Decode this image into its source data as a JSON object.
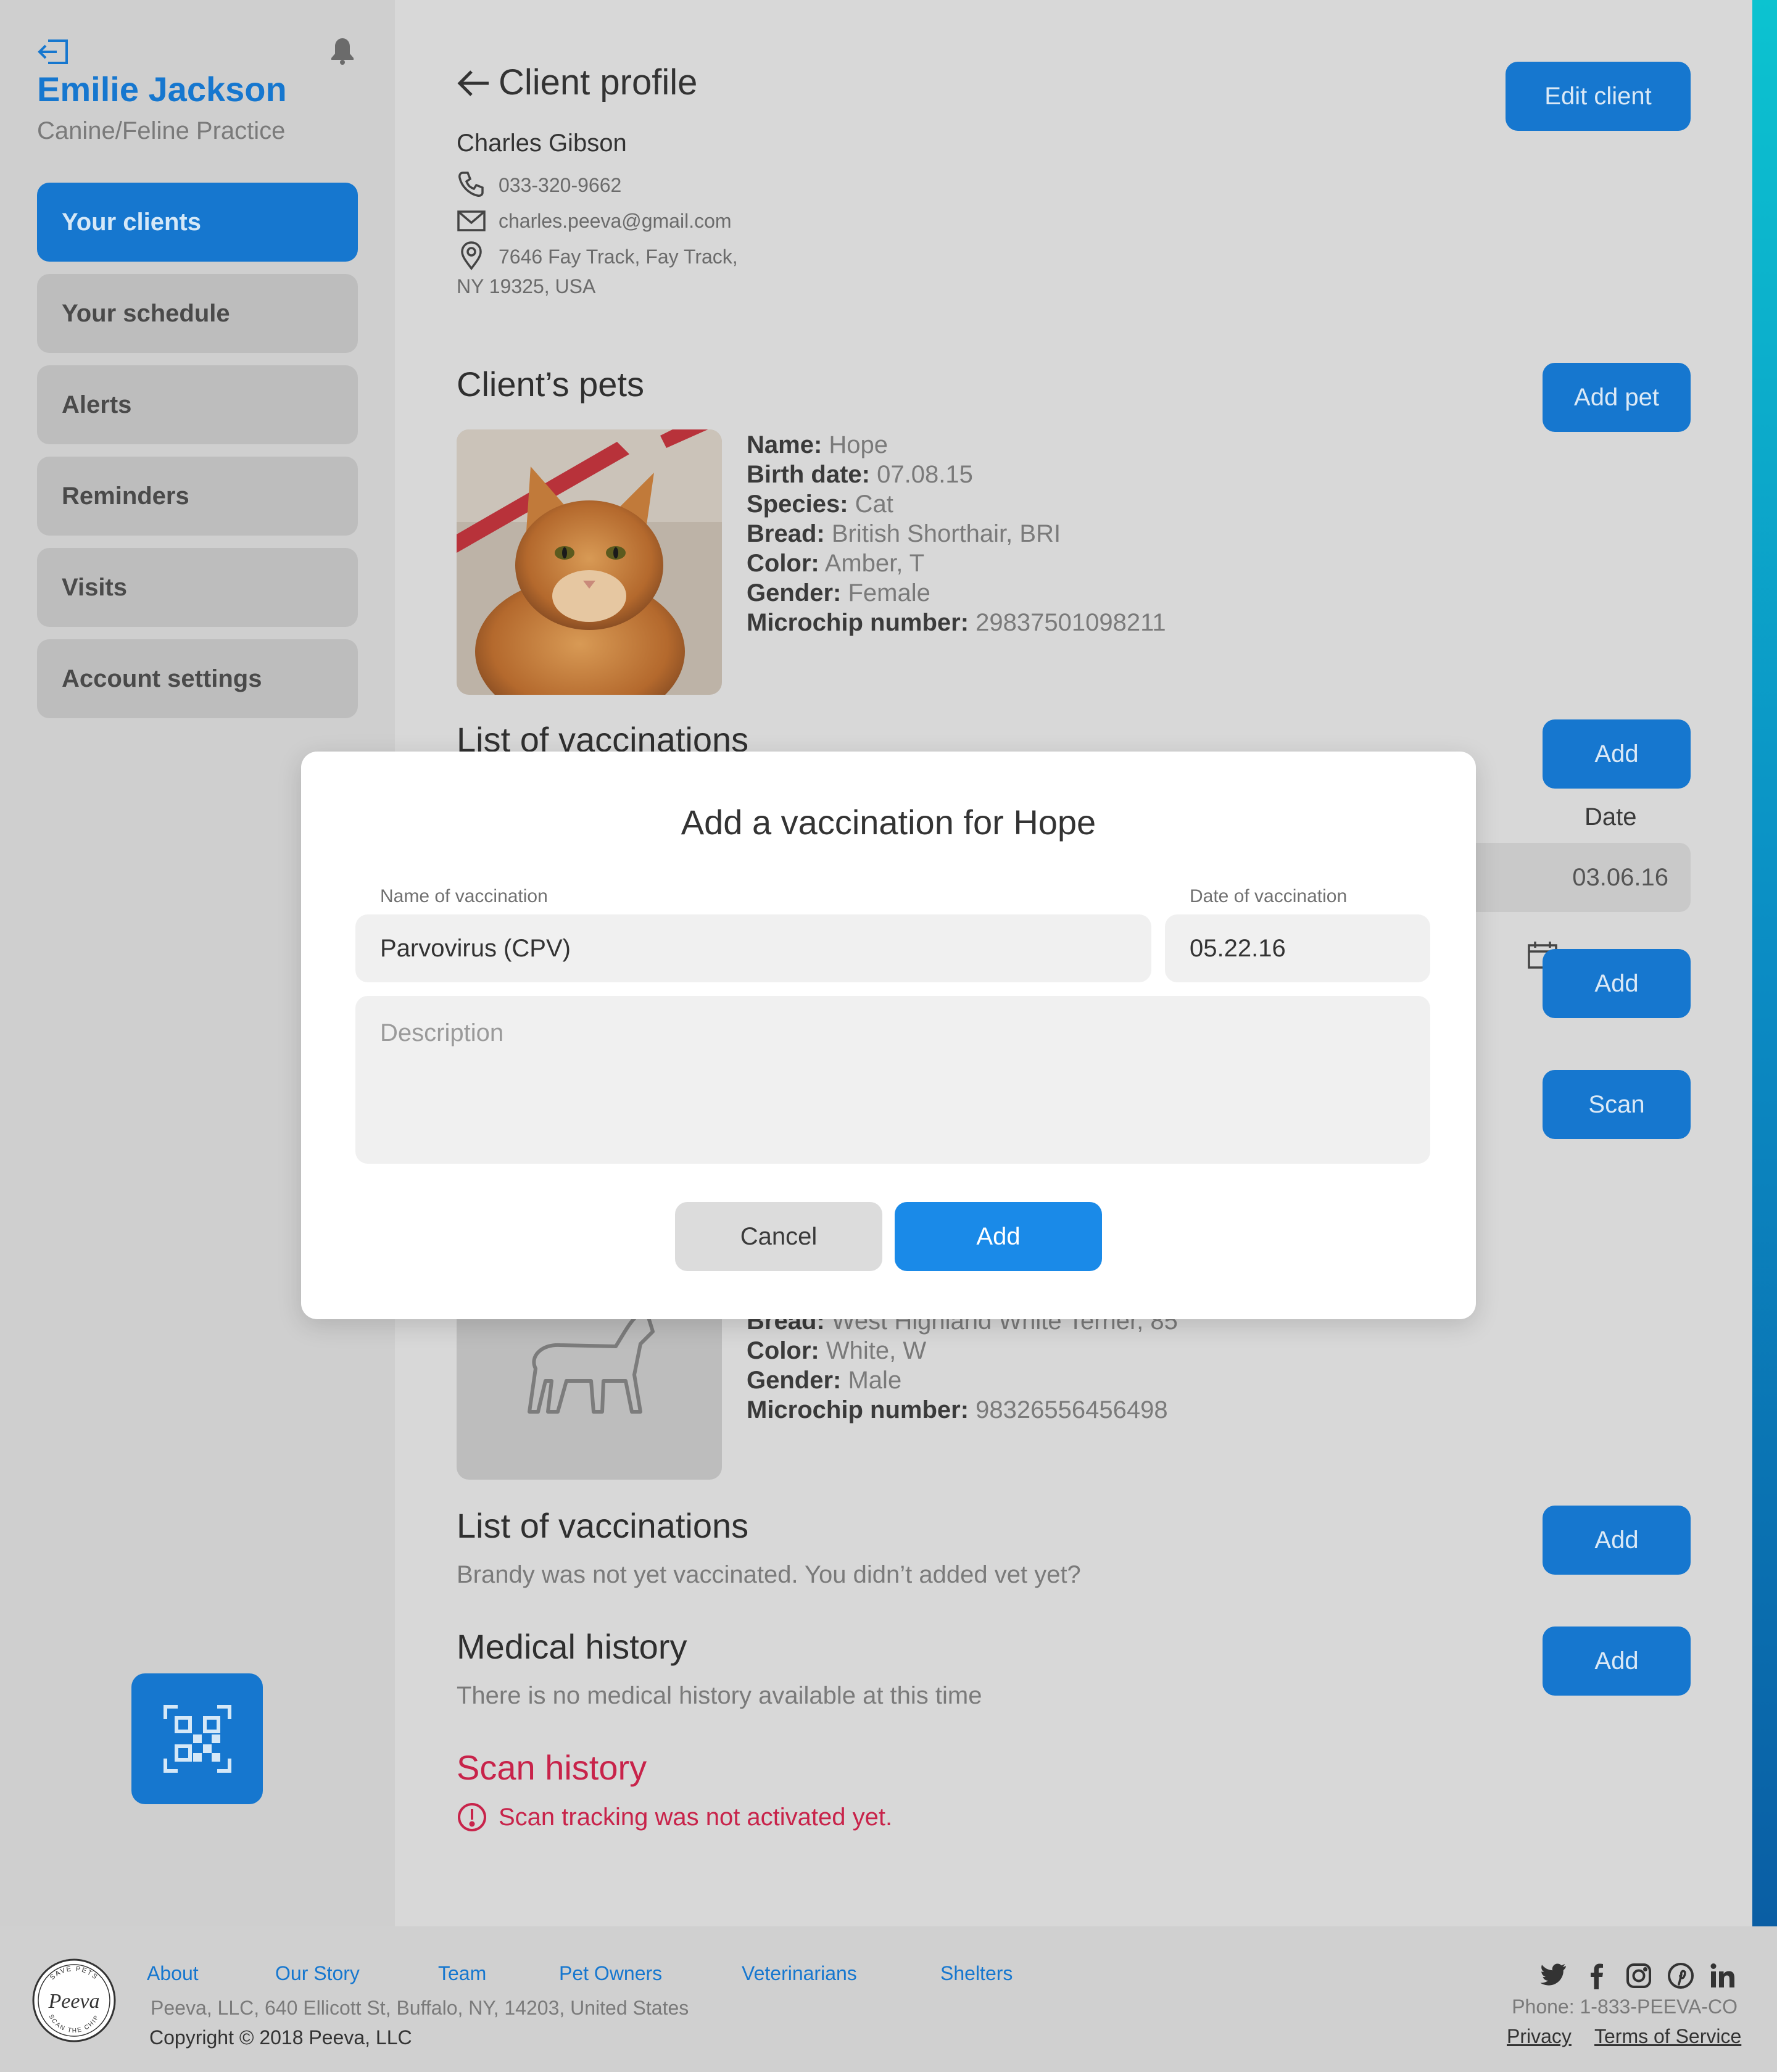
{
  "sidebar": {
    "user_name": "Emilie Jackson",
    "practice": "Canine/Feline Practice",
    "nav": [
      {
        "label": "Your clients",
        "active": true
      },
      {
        "label": "Your schedule",
        "active": false
      },
      {
        "label": "Alerts",
        "active": false
      },
      {
        "label": "Reminders",
        "active": false
      },
      {
        "label": "Visits",
        "active": false
      },
      {
        "label": "Account settings",
        "active": false
      }
    ],
    "icons": {
      "logout": "logout-icon",
      "bell": "bell-icon",
      "qr": "qr-code-icon"
    }
  },
  "header": {
    "title": "Client profile",
    "edit_button": "Edit client"
  },
  "client": {
    "name": "Charles Gibson",
    "phone": "033-320-9662",
    "email": "charles.peeva@gmail.com",
    "address_line1": "7646 Fay Track, Fay Track,",
    "address_line2": "NY 19325, USA"
  },
  "pets_section": {
    "title": "Client’s pets",
    "add_pet_button": "Add pet"
  },
  "pet1": {
    "labels": {
      "name": "Name:",
      "birth": "Birth date:",
      "species": "Species:",
      "bread": "Bread:",
      "color": "Color:",
      "gender": "Gender:",
      "chip": "Microchip number:"
    },
    "name": "Hope",
    "birth_date": "07.08.15",
    "species": "Cat",
    "bread": "British Shorthair, BRI",
    "color": "Amber, T",
    "gender": "Female",
    "microchip": "29837501098211",
    "vaccinations_title": "List of vaccinations",
    "add_label": "Add",
    "date_header": "Date",
    "date_value": "03.06.16",
    "add_label_2": "Add",
    "scan_label": "Scan"
  },
  "pet2": {
    "bread_label": "Bread:",
    "bread": "West Highland White Terrier, 85",
    "color_label": "Color:",
    "color": "White, W",
    "gender_label": "Gender:",
    "gender": "Male",
    "chip_label": "Microchip number:",
    "microchip": "98326556456498",
    "vaccinations_title": "List of vaccinations",
    "vaccinations_empty": "Brandy was not yet vaccinated. You didn’t added vet yet?",
    "vaccinations_add": "Add",
    "medical_title": "Medical history",
    "medical_empty": "There is no medical history available at this time",
    "medical_add": "Add",
    "scan_title": "Scan history",
    "scan_warning": "Scan tracking was not activated yet."
  },
  "modal": {
    "title": "Add a vaccination for Hope",
    "name_label": "Name of vaccination",
    "name_value": "Parvovirus (CPV)",
    "date_label": "Date of vaccination",
    "date_value": "05.22.16",
    "description_placeholder": "Description",
    "cancel": "Cancel",
    "add": "Add"
  },
  "footer": {
    "links": [
      "About",
      "Our Story",
      "Team",
      "Pet Owners",
      "Veterinarians",
      "Shelters"
    ],
    "address": "Peeva, LLC, 640 Ellicott St, Buffalo, NY, 14203, United States",
    "copyright": "Copyright © 2018 Peeva, LLC",
    "phone": "Phone: 1-833-PEEVA-CO",
    "privacy": "Privacy",
    "terms": "Terms of Service",
    "logo_text": "Peeva",
    "logo_ring_top": "SAVE PETS",
    "logo_ring_bottom": "SCAN THE CHIP",
    "social": [
      "twitter-icon",
      "facebook-icon",
      "instagram-icon",
      "pinterest-icon",
      "linkedin-icon"
    ]
  },
  "colors": {
    "primary": "#1677cf",
    "danger": "#c8234a",
    "accent_top": "#0cc3d0",
    "accent_bottom": "#0a5ea4"
  }
}
